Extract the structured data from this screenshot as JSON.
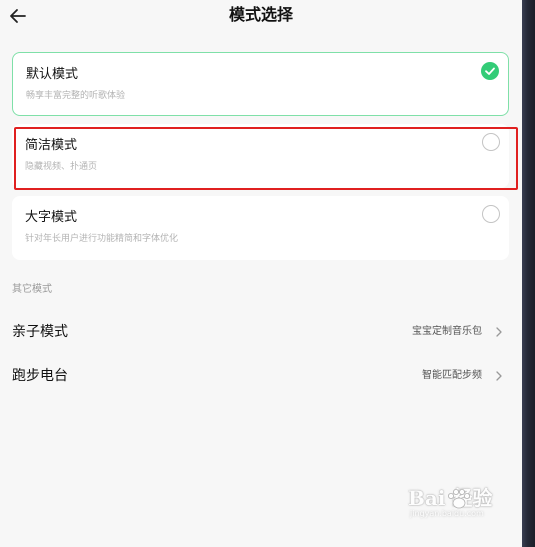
{
  "header": {
    "title": "模式选择",
    "back_icon": "arrow-left-icon"
  },
  "modes": [
    {
      "title": "默认模式",
      "subtitle": "畅享丰富完整的听歌体验",
      "selected": true
    },
    {
      "title": "简洁模式",
      "subtitle": "隐藏视频、扑通页",
      "selected": false,
      "highlighted": true
    },
    {
      "title": "大字模式",
      "subtitle": "针对年长用户进行功能精简和字体优化",
      "selected": false
    }
  ],
  "other_section": {
    "label": "其它模式",
    "items": [
      {
        "title": "亲子模式",
        "value": "宝宝定制音乐包"
      },
      {
        "title": "跑步电台",
        "value": "智能匹配步频"
      }
    ]
  },
  "watermark": {
    "brand": "Bai  经验",
    "url": "jingyan.baidu.com"
  },
  "colors": {
    "accent": "#33cc77",
    "selected_border": "#7fe0a8",
    "highlight": "#e02020",
    "background": "#f7f7f7"
  }
}
